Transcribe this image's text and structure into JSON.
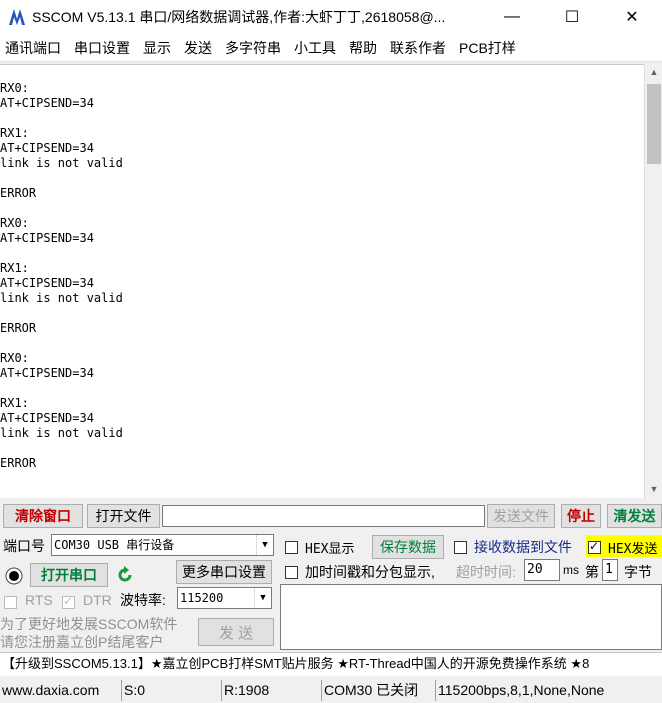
{
  "window": {
    "title": "SSCOM V5.13.1 串口/网络数据调试器,作者:大虾丁丁,2618058@...",
    "minimize": "—",
    "maximize": "☐",
    "close": "✕"
  },
  "menu": [
    "通讯端口",
    "串口设置",
    "显示",
    "发送",
    "多字符串",
    "小工具",
    "帮助",
    "联系作者",
    "PCB打样"
  ],
  "terminal": {
    "text": "RX0:\nAT+CIPSEND=34\n\nRX1:\nAT+CIPSEND=34\nlink is not valid\n\nERROR\n\nRX0:\nAT+CIPSEND=34\n\nRX1:\nAT+CIPSEND=34\nlink is not valid\n\nERROR\n\nRX0:\nAT+CIPSEND=34\n\nRX1:\nAT+CIPSEND=34\nlink is not valid\n\nERROR"
  },
  "toolbar": {
    "clear_window": "清除窗口",
    "open_file": "打开文件",
    "send_file": "发送文件",
    "stop": "停止",
    "clear_send": "清发送"
  },
  "port": {
    "label": "端口号",
    "value": "COM30 USB 串行设备",
    "open_button": "打开串口",
    "more_settings": "更多串口设置",
    "rts": "RTS",
    "dtr": "DTR",
    "baud_label": "波特率:",
    "baud_value": "115200"
  },
  "options": {
    "hex_display": "HEX显示",
    "save_data": "保存数据",
    "receive_to_file": "接收数据到文件",
    "hex_send": "HEX发送",
    "timestamp": "加时间戳和分包显示,",
    "timeout_label": "超时时间:",
    "timeout_value": "20",
    "ms": "ms",
    "nth_label": "第",
    "nth_value": "1",
    "byte_label": "字节"
  },
  "ad": {
    "line1": "为了更好地发展SSCOM软件",
    "line2": "请您注册嘉立创P结尾客户",
    "send_button": "发 送"
  },
  "banner": "【升级到SSCOM5.13.1】★嘉立创PCB打样SMT贴片服务 ★RT-Thread中国人的开源免费操作系统 ★8",
  "status": {
    "website": "www.daxia.com",
    "sent": "S:0",
    "received": "R:1908",
    "port_state": "COM30 已关闭",
    "params": "115200bps,8,1,None,None"
  },
  "colors": {
    "clear_window_text": "#c00000",
    "open_port_text": "#00803c",
    "hex_send_bg": "#ffff00"
  }
}
